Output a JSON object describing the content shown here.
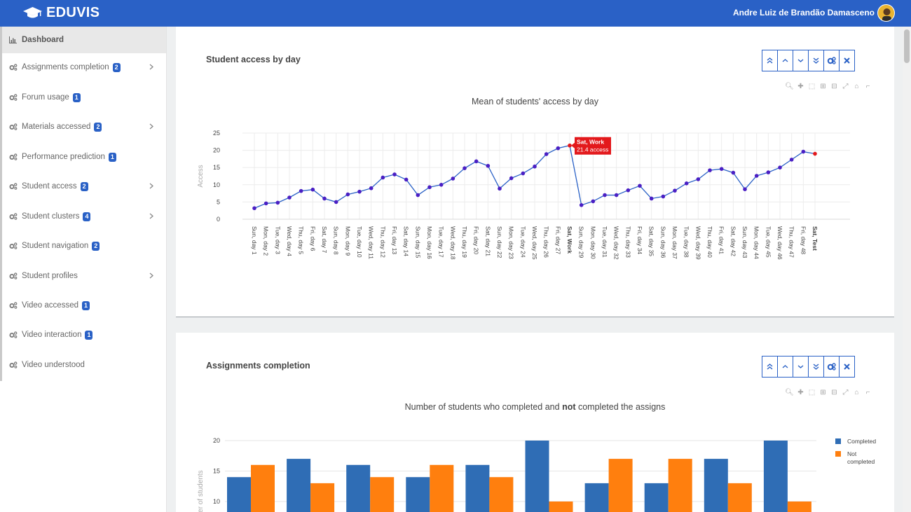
{
  "header": {
    "brand": "EDUVIS",
    "user_name": "Andre Luiz de Brandão Damasceno",
    "colors": {
      "bar": "#2a61c6",
      "badge": "#2a61c6"
    }
  },
  "sidebar": {
    "items": [
      {
        "label": "Dashboard",
        "active": true,
        "icon": "bar-chart-icon"
      },
      {
        "label": "Assignments completion",
        "badge": "2",
        "expandable": true,
        "icon": "cogs-icon"
      },
      {
        "label": "Forum usage",
        "badge": "1",
        "icon": "cogs-icon"
      },
      {
        "label": "Materials accessed",
        "badge": "2",
        "expandable": true,
        "icon": "cogs-icon"
      },
      {
        "label": "Performance prediction",
        "badge": "1",
        "icon": "cogs-icon"
      },
      {
        "label": "Student access",
        "badge": "2",
        "expandable": true,
        "icon": "cogs-icon"
      },
      {
        "label": "Student clusters",
        "badge": "4",
        "expandable": true,
        "icon": "cogs-icon"
      },
      {
        "label": "Student navigation",
        "badge": "2",
        "icon": "cogs-icon"
      },
      {
        "label": "Student profiles",
        "expandable": true,
        "icon": "cogs-icon"
      },
      {
        "label": "Video accessed",
        "badge": "1",
        "icon": "cogs-icon"
      },
      {
        "label": "Video interaction",
        "badge": "1",
        "icon": "cogs-icon"
      },
      {
        "label": "Video understood",
        "icon": "cogs-icon"
      }
    ]
  },
  "panels": [
    {
      "title": "Student access by day"
    },
    {
      "title": "Assignments completion"
    }
  ],
  "chart_data": [
    {
      "type": "line",
      "title": "Mean of students' access by day",
      "ylabel": "Access",
      "ylim": [
        0,
        25
      ],
      "yticks": [
        0,
        5,
        10,
        15,
        20,
        25
      ],
      "grid": true,
      "line_color": "#2a61c6",
      "marker_color": "#4a1fc4",
      "highlight_color": "#e3191c",
      "categories": [
        "Sun, day 1",
        "Mon, day 2",
        "Tue, day 3",
        "Wed, day 4",
        "Thu, day 5",
        "Fri, day 6",
        "Sat, day 7",
        "Sun, day 8",
        "Mon, day 9",
        "Tue, day 10",
        "Wed, day 11",
        "Thu, day 12",
        "Fri, day 13",
        "Sat, day 14",
        "Sun, day 15",
        "Mon, day 16",
        "Tue, day 17",
        "Wed, day 18",
        "Thu, day 19",
        "Fri, day 20",
        "Sat, day 21",
        "Sun, day 22",
        "Mon, day 23",
        "Tue, day 24",
        "Wed, day 25",
        "Thu, day 26",
        "Fri, day 27",
        "Sat, Work",
        "Sun, day 29",
        "Mon, day 30",
        "Tue, day 31",
        "Wed, day 32",
        "Thu, day 33",
        "Fri, day 34",
        "Sat, day 35",
        "Sun, day 36",
        "Mon, day 37",
        "Tue, day 38",
        "Wed, day 39",
        "Thu, day 40",
        "Fri, day 41",
        "Sat, day 42",
        "Sun, day 43",
        "Mon, day 44",
        "Tue, day 45",
        "Wed, day 46",
        "Thu, day 47",
        "Fri, day 48",
        "Sat, Test"
      ],
      "bold_categories": [
        "Sat, Work",
        "Sat, Test"
      ],
      "values": [
        3.2,
        4.6,
        4.8,
        6.3,
        8.2,
        8.6,
        6.0,
        5.0,
        7.2,
        8.0,
        9.0,
        12.1,
        13.0,
        11.5,
        7.0,
        9.3,
        10.0,
        11.8,
        14.8,
        16.8,
        15.5,
        8.9,
        11.9,
        13.3,
        15.3,
        18.9,
        20.6,
        21.4,
        4.1,
        5.2,
        7.0,
        7.0,
        8.4,
        9.7,
        6.0,
        6.6,
        8.3,
        10.4,
        11.6,
        14.2,
        14.6,
        13.5,
        8.7,
        12.6,
        13.6,
        15.0,
        17.3,
        19.6,
        19.0
      ],
      "highlighted": [
        27,
        48
      ],
      "tooltip": {
        "index": 27,
        "line1": "Sat, Work",
        "line2": "21.4 access"
      }
    },
    {
      "type": "bar",
      "title_parts": [
        "Number of students who completed and ",
        "not",
        " completed the assigns"
      ],
      "ylabel": "Number of students",
      "yticks": [
        10,
        15,
        20
      ],
      "ylim": [
        10,
        20
      ],
      "grid": true,
      "legend_position": "right",
      "series": [
        {
          "name": "Completed",
          "color": "#2f6db5",
          "values": [
            14,
            17,
            16,
            14,
            16,
            20,
            13,
            13,
            17,
            20
          ]
        },
        {
          "name": "Not completed",
          "color": "#ff7f0e",
          "values": [
            16,
            13,
            14,
            16,
            14,
            10,
            17,
            17,
            13,
            10
          ]
        }
      ],
      "legend_labels": [
        [
          "Completed"
        ],
        [
          "Not",
          "completed"
        ]
      ]
    }
  ]
}
